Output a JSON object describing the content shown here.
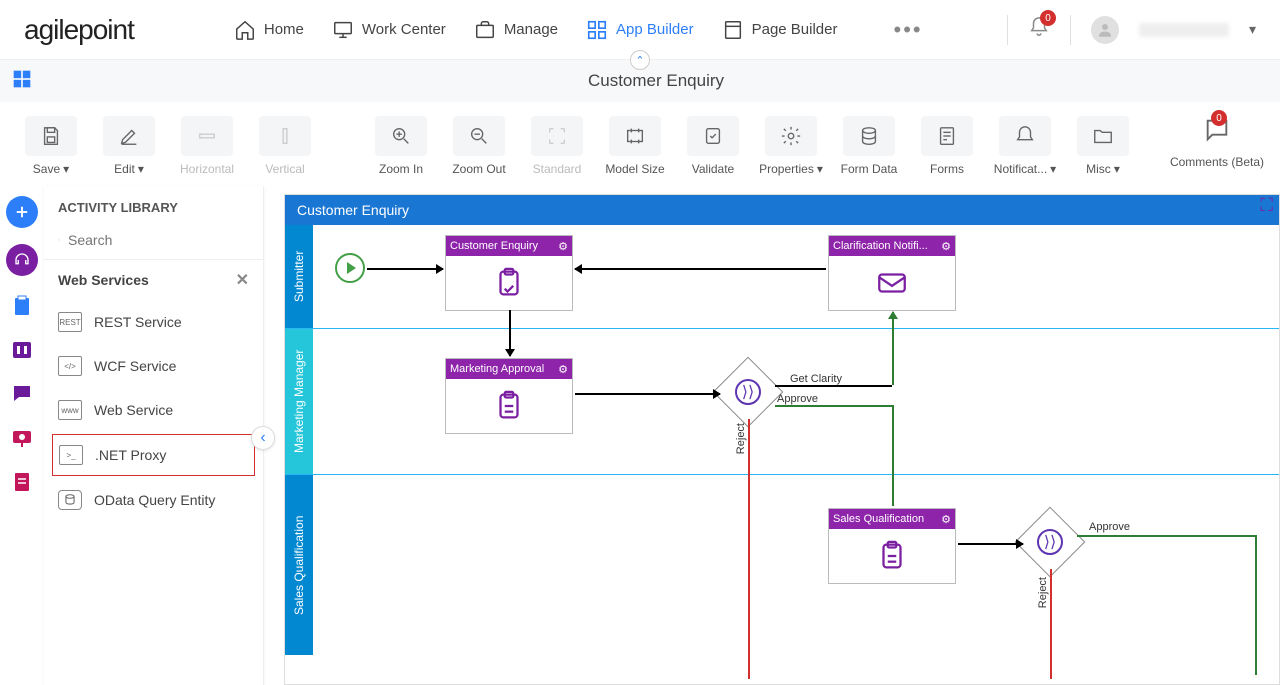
{
  "brand": "agilepoint",
  "nav": {
    "home": "Home",
    "work_center": "Work Center",
    "manage": "Manage",
    "app_builder": "App Builder",
    "page_builder": "Page Builder"
  },
  "notifications": {
    "count": "0"
  },
  "subheader": {
    "title": "Customer Enquiry"
  },
  "toolbar": {
    "save": "Save",
    "edit": "Edit",
    "horizontal": "Horizontal",
    "vertical": "Vertical",
    "zoom_in": "Zoom In",
    "zoom_out": "Zoom Out",
    "standard": "Standard",
    "model_size": "Model Size",
    "validate": "Validate",
    "properties": "Properties",
    "form_data": "Form Data",
    "forms": "Forms",
    "notifications": "Notificat...",
    "misc": "Misc",
    "comments": "Comments (Beta)",
    "comments_count": "0"
  },
  "panel": {
    "header": "ACTIVITY LIBRARY",
    "search_placeholder": "Search",
    "category": "Web Services",
    "items": {
      "rest": "REST Service",
      "wcf": "WCF Service",
      "web": "Web Service",
      "netproxy": ".NET Proxy",
      "odata": "OData Query Entity"
    }
  },
  "canvas": {
    "title": "Customer Enquiry",
    "lanes": {
      "submitter": "Submitter",
      "marketing": "Marketing Manager",
      "sales": "Sales Qualification"
    },
    "activities": {
      "customer_enquiry": "Customer Enquiry",
      "clarification": "Clarification Notifi...",
      "marketing_approval": "Marketing Approval",
      "sales_qualification": "Sales Qualification"
    },
    "edges": {
      "get_clarity": "Get Clarity",
      "approve": "Approve",
      "reject": "Reject",
      "approve2": "Approve",
      "reject2": "Reject"
    }
  }
}
